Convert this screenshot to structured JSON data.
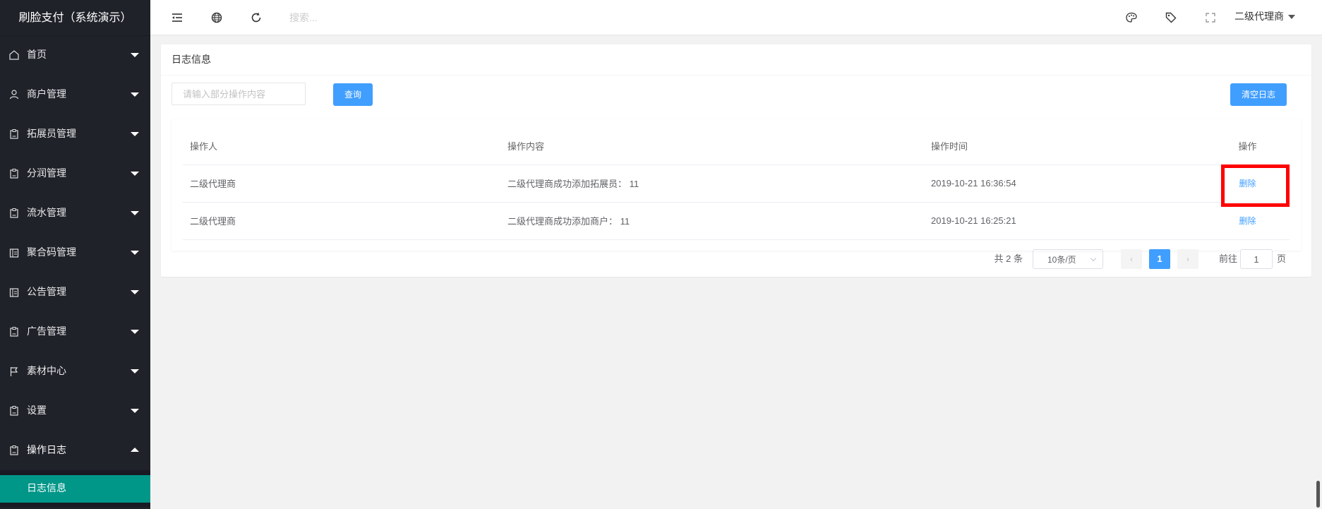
{
  "app": {
    "title": "刷脸支付（系统演示）"
  },
  "sidebar": {
    "items": [
      {
        "label": "首页",
        "icon": "home-icon"
      },
      {
        "label": "商户管理",
        "icon": "user-icon"
      },
      {
        "label": "拓展员管理",
        "icon": "clipboard-icon"
      },
      {
        "label": "分润管理",
        "icon": "clipboard-icon"
      },
      {
        "label": "流水管理",
        "icon": "clipboard-icon"
      },
      {
        "label": "聚合码管理",
        "icon": "template-icon"
      },
      {
        "label": "公告管理",
        "icon": "template-icon"
      },
      {
        "label": "广告管理",
        "icon": "clipboard-icon"
      },
      {
        "label": "素材中心",
        "icon": "flag-icon"
      },
      {
        "label": "设置",
        "icon": "clipboard-icon"
      },
      {
        "label": "操作日志",
        "icon": "clipboard-icon"
      }
    ],
    "open_submenu": {
      "label": "日志信息"
    }
  },
  "header": {
    "search_placeholder": "搜索...",
    "user": "二级代理商"
  },
  "card": {
    "title": "日志信息",
    "filter_placeholder": "请输入部分操作内容",
    "query_label": "查询",
    "clear_label": "清空日志"
  },
  "table": {
    "columns": [
      "操作人",
      "操作内容",
      "操作时间",
      "操作"
    ],
    "rows": [
      {
        "operator": "二级代理商",
        "content": "二级代理商成功添加拓展员： 11",
        "time": "2019-10-21 16:36:54",
        "action": "删除"
      },
      {
        "operator": "二级代理商",
        "content": "二级代理商成功添加商户： 11",
        "time": "2019-10-21 16:25:21",
        "action": "删除"
      }
    ]
  },
  "pager": {
    "total": "共 2 条",
    "page_size": "10条/页",
    "prev": "‹",
    "current": "1",
    "next": "›",
    "goto_label": "前往",
    "goto_value": "1",
    "goto_suffix": "页"
  },
  "colors": {
    "sidebar_bg": "#20222a",
    "active_item": "#009688",
    "primary": "#409eff",
    "highlight": "#ff0000"
  }
}
